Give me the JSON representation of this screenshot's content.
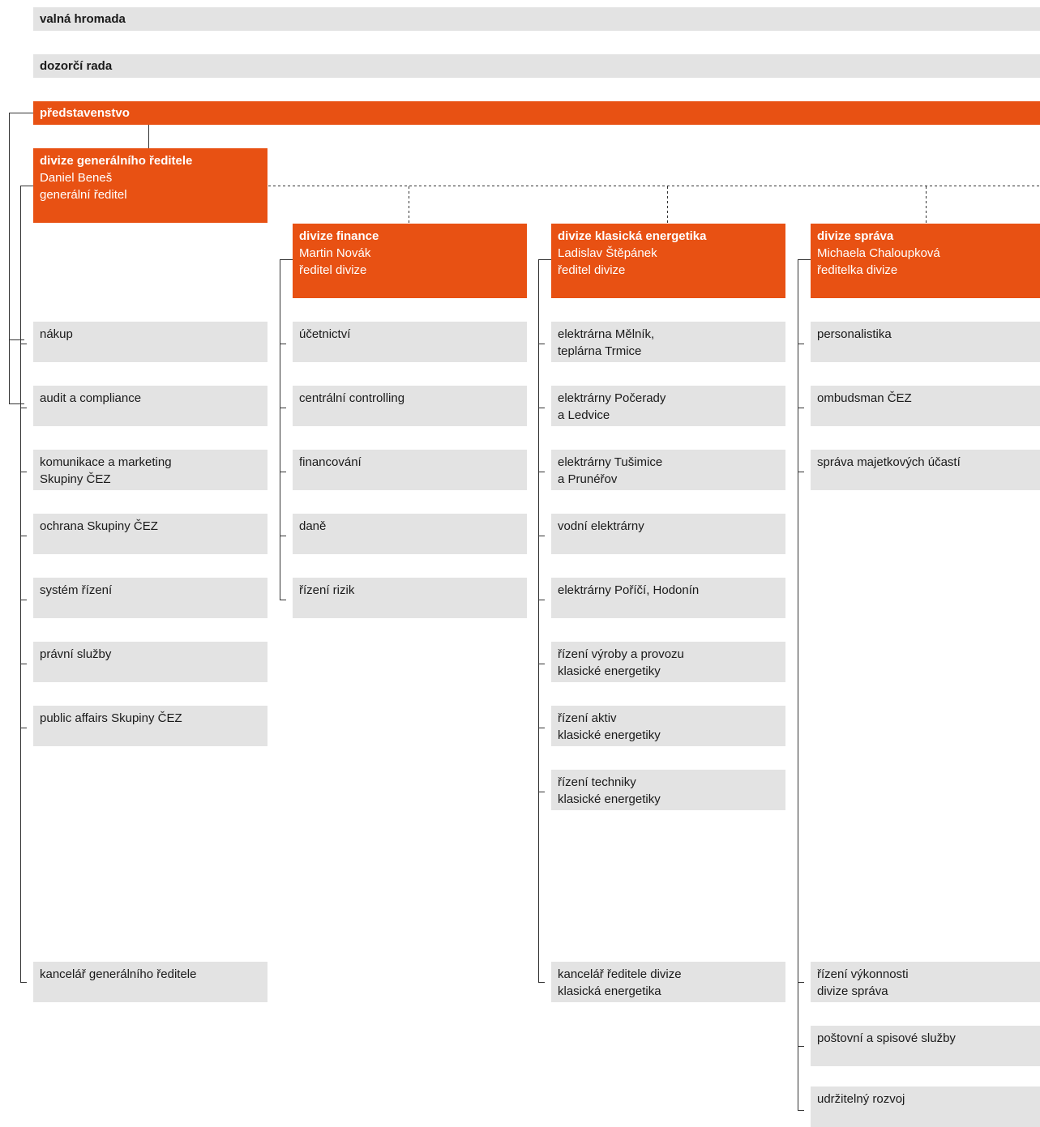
{
  "top": {
    "valna_hromada": "valná hromada",
    "dozorci_rada": "dozorčí rada",
    "predstavenstvo": "představenstvo"
  },
  "divisions": [
    {
      "title": "divize generálního ředitele",
      "person": "Daniel Beneš",
      "role": "generální ředitel",
      "units": [
        "nákup",
        "audit a compliance",
        "komunikace a marketing\nSkupiny ČEZ",
        "ochrana Skupiny ČEZ",
        "systém řízení",
        "právní služby",
        "public affairs Skupiny ČEZ",
        "kancelář generálního ředitele"
      ]
    },
    {
      "title": "divize finance",
      "person": "Martin Novák",
      "role": "ředitel divize",
      "units": [
        "účetnictví",
        "centrální controlling",
        "financování",
        "daně",
        "řízení rizik"
      ]
    },
    {
      "title": "divize klasická energetika",
      "person": "Ladislav Štěpánek",
      "role": "ředitel divize",
      "units": [
        "elektrárna Mělník,\nteplárna Trmice",
        "elektrárny Počerady\na Ledvice",
        "elektrárny Tušimice\na Prunéřov",
        "vodní elektrárny",
        "elektrárny Poříčí, Hodonín",
        "řízení výroby a provozu\nklasické energetiky",
        "řízení aktiv\nklasické energetiky",
        "řízení techniky\nklasické energetiky",
        "kancelář ředitele divize\nklasická energetika"
      ]
    },
    {
      "title": "divize správa",
      "person": "Michaela Chaloupková",
      "role": "ředitelka divize",
      "units": [
        "personalistika",
        "ombudsman ČEZ",
        "správa majetkových účastí",
        "řízení výkonnosti\ndivize správa",
        "poštovní a spisové služby",
        "udržitelný rozvoj"
      ]
    }
  ]
}
